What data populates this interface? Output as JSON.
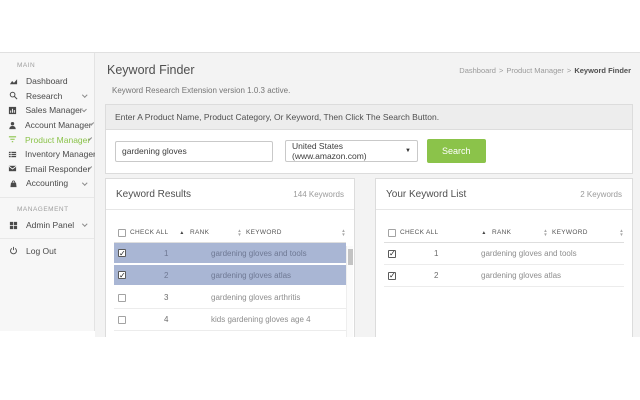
{
  "colors": {
    "accent_green": "#8bc34a",
    "row_highlight": "#a9b6d4",
    "sidebar_bg": "#f7f7f7",
    "main_bg": "#f3f3f3"
  },
  "sidebar": {
    "sections": [
      {
        "label": "MAIN",
        "items": [
          {
            "label": "Dashboard",
            "icon": "chart-area-icon"
          },
          {
            "label": "Research",
            "icon": "search-icon"
          },
          {
            "label": "Sales Manager",
            "icon": "bar-chart-icon"
          },
          {
            "label": "Account Manager",
            "icon": "user-icon"
          },
          {
            "label": "Product Manager",
            "icon": "filter-icon",
            "active": true
          },
          {
            "label": "Inventory Manager",
            "icon": "table-icon"
          },
          {
            "label": "Email Responder",
            "icon": "envelope-icon"
          },
          {
            "label": "Accounting",
            "icon": "basket-icon"
          }
        ]
      },
      {
        "label": "MANAGEMENT",
        "items": [
          {
            "label": "Admin Panel",
            "icon": "grid-icon"
          },
          {
            "label": "Log Out",
            "icon": "power-icon"
          }
        ]
      }
    ]
  },
  "header": {
    "title": "Keyword Finder",
    "breadcrumb_separator": ">",
    "breadcrumb": {
      "home": "Dashboard",
      "section": "Product Manager",
      "current": "Keyword Finder"
    }
  },
  "status_text": "Keyword Research Extension version 1.0.3 active.",
  "search": {
    "instruction": "Enter A Product Name, Product Category, Or Keyword, Then Click The Search Button.",
    "input_value": "gardening gloves",
    "marketplace_selected": "United States (www.amazon.com)",
    "button_label": "Search"
  },
  "results_panel": {
    "title": "Keyword Results",
    "count": "144 Keywords",
    "columns": {
      "check_label": "CHECK ALL",
      "rank_label": "RANK",
      "keyword_label": "KEYWORD",
      "sort_asc_icon": "sort-asc-icon",
      "sort_icon": "sort-both-icon"
    },
    "rows": [
      {
        "rank": "1",
        "keyword": "gardening gloves and tools",
        "checked": true,
        "highlighted": true
      },
      {
        "rank": "2",
        "keyword": "gardening gloves atlas",
        "checked": true,
        "highlighted": true
      },
      {
        "rank": "3",
        "keyword": "gardening gloves arthritis",
        "checked": false,
        "highlighted": false
      },
      {
        "rank": "4",
        "keyword": "kids gardening gloves age 4",
        "checked": false,
        "highlighted": false
      }
    ]
  },
  "list_panel": {
    "title": "Your Keyword List",
    "count": "2 Keywords",
    "columns": {
      "check_label": "CHECK ALL",
      "rank_label": "RANK",
      "keyword_label": "KEYWORD",
      "sort_asc_icon": "sort-asc-icon",
      "sort_icon": "sort-both-icon"
    },
    "rows": [
      {
        "rank": "1",
        "keyword": "gardening gloves and tools",
        "checked": true
      },
      {
        "rank": "2",
        "keyword": "gardening gloves atlas",
        "checked": true
      }
    ]
  }
}
